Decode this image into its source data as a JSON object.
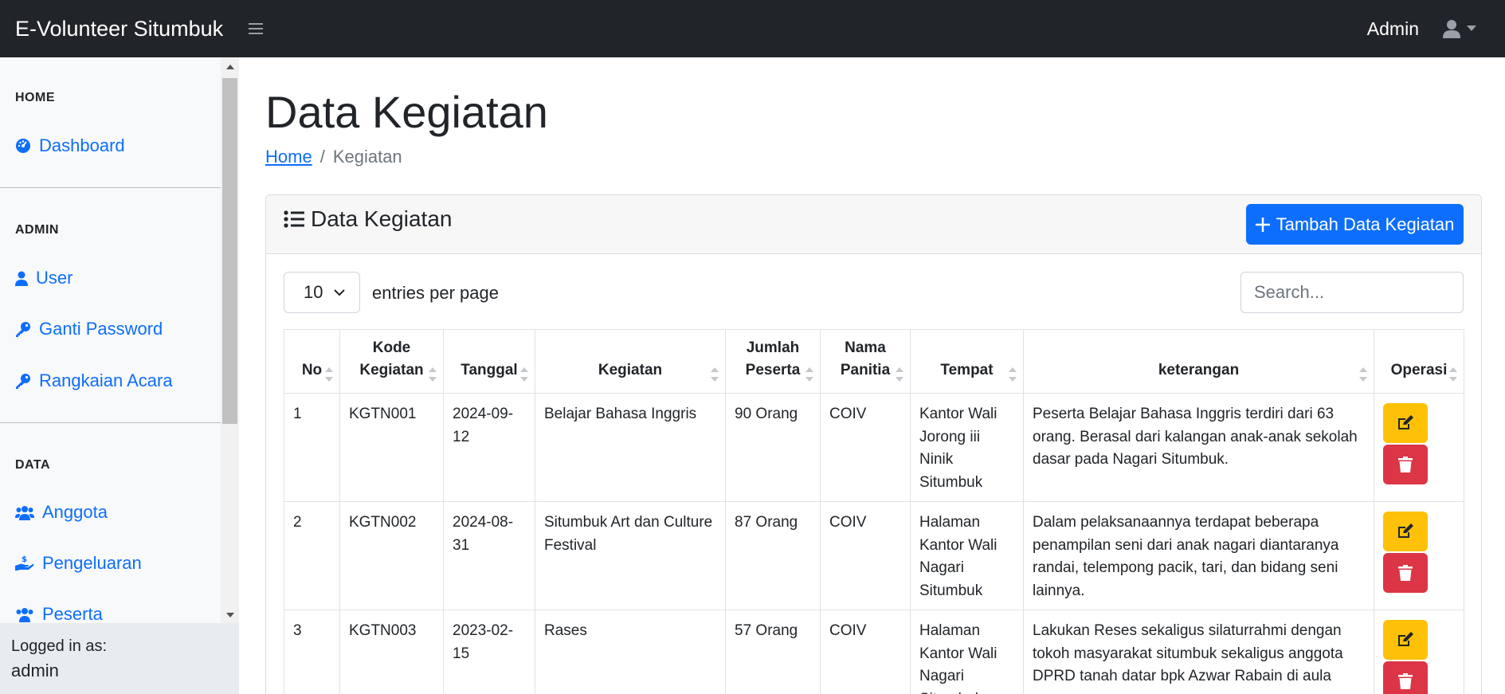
{
  "app": {
    "title": "E-Volunteer Situmbuk",
    "admin_label": "Admin"
  },
  "sidebar": {
    "sections": [
      {
        "heading": "HOME",
        "items": [
          {
            "label": "Dashboard",
            "icon": "tachometer-icon"
          }
        ]
      },
      {
        "heading": "ADMIN",
        "items": [
          {
            "label": "User",
            "icon": "user-icon"
          },
          {
            "label": "Ganti Password",
            "icon": "key-icon"
          },
          {
            "label": "Rangkaian Acara",
            "icon": "key-icon"
          }
        ]
      },
      {
        "heading": "DATA",
        "items": [
          {
            "label": "Anggota",
            "icon": "users-icon"
          },
          {
            "label": "Pengeluaran",
            "icon": "hand-money-icon"
          },
          {
            "label": "Peserta",
            "icon": "users-icon"
          }
        ]
      }
    ],
    "footer": {
      "label": "Logged in as:",
      "user": "admin"
    }
  },
  "main": {
    "page_title": "Data Kegiatan",
    "breadcrumb": {
      "home": "Home",
      "current": "Kegiatan",
      "separator": "/"
    },
    "card": {
      "title": "Data Kegiatan",
      "add_button": "Tambah Data Kegiatan",
      "entries_value": "10",
      "entries_label": "entries per page",
      "search_placeholder": "Search..."
    },
    "table": {
      "headers": [
        "No",
        "Kode Kegiatan",
        "Tanggal",
        "Kegiatan",
        "Jumlah Peserta",
        "Nama Panitia",
        "Tempat",
        "keterangan",
        "Operasi"
      ],
      "rows": [
        {
          "no": "1",
          "kode": "KGTN001",
          "tanggal": "2024-09-12",
          "kegiatan": "Belajar Bahasa Inggris",
          "jumlah": "90 Orang",
          "panitia": "COIV",
          "tempat": "Kantor Wali Jorong iii Ninik Situmbuk",
          "keterangan": "Peserta Belajar Bahasa Inggris terdiri dari 63 orang. Berasal dari kalangan anak-anak sekolah dasar pada Nagari Situmbuk."
        },
        {
          "no": "2",
          "kode": "KGTN002",
          "tanggal": "2024-08-31",
          "kegiatan": "Situmbuk Art dan Culture Festival",
          "jumlah": "87 Orang",
          "panitia": "COIV",
          "tempat": "Halaman Kantor Wali Nagari Situmbuk",
          "keterangan": "Dalam pelaksanaannya terdapat beberapa penampilan seni dari anak nagari diantaranya randai, telempong pacik, tari, dan bidang seni lainnya."
        },
        {
          "no": "3",
          "kode": "KGTN003",
          "tanggal": "2023-02-15",
          "kegiatan": "Rases",
          "jumlah": "57 Orang",
          "panitia": "COIV",
          "tempat": "Halaman Kantor Wali Nagari Situmbuk",
          "keterangan": "Lakukan Reses sekaligus silaturrahmi dengan tokoh masyarakat situmbuk sekaligus anggota DPRD tanah datar bpk Azwar Rabain di aula"
        }
      ]
    }
  },
  "colors": {
    "primary": "#0d6efd",
    "warning": "#ffc107",
    "danger": "#dc3545",
    "navbar": "#212529"
  }
}
